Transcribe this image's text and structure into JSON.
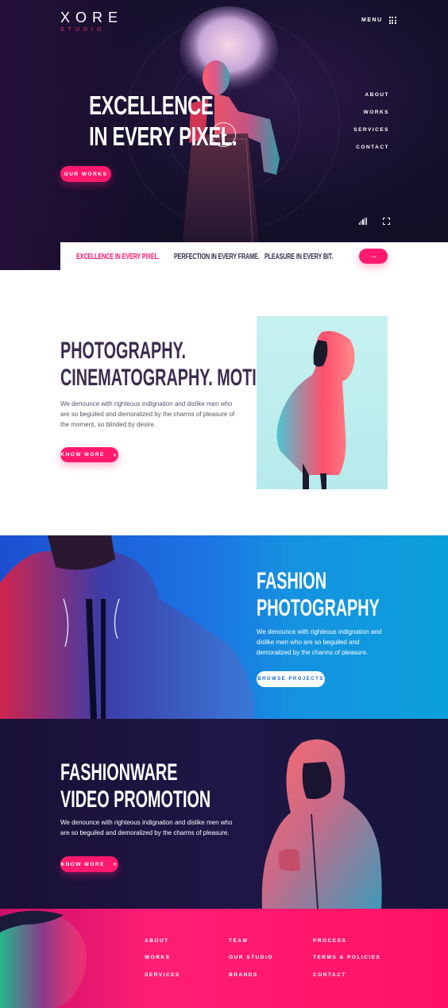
{
  "brand": {
    "name": "XORE",
    "sub": "STUDIO"
  },
  "header": {
    "menu_label": "MENU"
  },
  "side_nav": [
    "ABOUT",
    "WORKS",
    "SERVICES",
    "CONTACT"
  ],
  "hero": {
    "headline_1": "EXCELLENCE",
    "headline_2": "IN EVERY PIXEL.",
    "cta": "OUR WORKS"
  },
  "ticker": {
    "items": [
      "EXCELLENCE IN EVERY PIXEL.",
      "PERFECTION IN EVERY FRAME.",
      "PLEASURE IN EVERY BIT."
    ],
    "arrow": "→"
  },
  "services": {
    "title_1": "PHOTOGRAPHY.",
    "title_2": "CINEMATOGRAPHY. MOTION.",
    "body": "We denounce with righteous indignation and dislike men who are so beguiled and demoralized by the charms of pleasure of the moment, so blinded by desire.",
    "cta": "KNOW MORE",
    "cta_icon": "+"
  },
  "fashion": {
    "title_1": "FASHION",
    "title_2": "PHOTOGRAPHY",
    "body": "We denounce with righteous indignation and dislike men who are so beguiled and demoralized by the charms of pleasure.",
    "cta": "BROWSE PROJECTS"
  },
  "video": {
    "title_1": "FASHIONWARE",
    "title_2": "VIDEO PROMOTION",
    "body": "We denounce with righteous indignation and dislike men who are so beguiled and demoralized by the charms of pleasure.",
    "cta": "KNOW MORE",
    "cta_icon": "+"
  },
  "footer": {
    "col1": [
      "ABOUT",
      "WORKS",
      "SERVICES"
    ],
    "col2": [
      "TEAM",
      "OUR STUDIO",
      "BRANDS"
    ],
    "col3": [
      "PROCESS",
      "TERMS & POLICIES",
      "CONTACT"
    ]
  },
  "colors": {
    "accent": "#ff1a6e",
    "hero_bg": "#15102c",
    "fashion_bg": "#1d72e3",
    "video_bg": "#1f1646",
    "footer_bg": "#ff1e73",
    "heading_dark": "#3b2c4e"
  },
  "icons": [
    "menu-grid-icon",
    "play-icon",
    "bars-icon",
    "fullscreen-icon",
    "arrow-right-icon",
    "plus-icon"
  ]
}
